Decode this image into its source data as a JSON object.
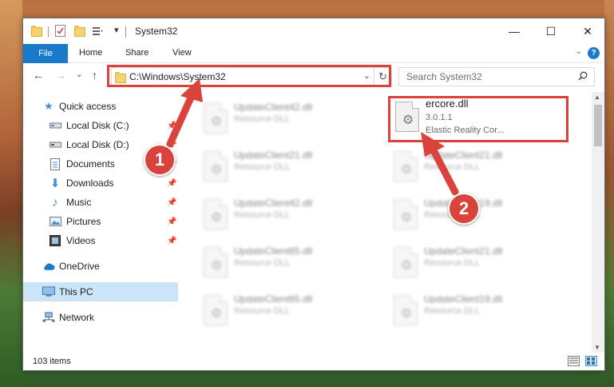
{
  "window": {
    "title": "System32",
    "controls": {
      "minimize": "—",
      "maximize": "☐",
      "close": "✕"
    }
  },
  "ribbon": {
    "file_tab": "File",
    "tabs": [
      "Home",
      "Share",
      "View"
    ],
    "help": "?"
  },
  "navigation": {
    "address": "C:\\Windows\\System32",
    "search_placeholder": "Search System32"
  },
  "sidebar": {
    "items": [
      {
        "label": "Quick access",
        "icon": "star-icon",
        "pinned": false,
        "selected": false
      },
      {
        "label": "Local Disk (C:)",
        "icon": "drive-icon",
        "pinned": true,
        "selected": false
      },
      {
        "label": "Local Disk (D:)",
        "icon": "drive-icon",
        "pinned": true,
        "selected": false
      },
      {
        "label": "Documents",
        "icon": "document-icon",
        "pinned": true,
        "selected": false
      },
      {
        "label": "Downloads",
        "icon": "download-icon",
        "pinned": true,
        "selected": false
      },
      {
        "label": "Music",
        "icon": "music-icon",
        "pinned": true,
        "selected": false
      },
      {
        "label": "Pictures",
        "icon": "pictures-icon",
        "pinned": true,
        "selected": false
      },
      {
        "label": "Videos",
        "icon": "videos-icon",
        "pinned": true,
        "selected": false
      },
      {
        "label": "OneDrive",
        "icon": "cloud-icon",
        "pinned": false,
        "selected": false
      },
      {
        "label": "This PC",
        "icon": "computer-icon",
        "pinned": false,
        "selected": true
      },
      {
        "label": "Network",
        "icon": "network-icon",
        "pinned": false,
        "selected": false
      }
    ]
  },
  "files": {
    "highlighted": {
      "name": "ercore.dll",
      "version": "3.0.1.1",
      "company": "Elastic Reality Cor..."
    },
    "left_column": [
      {
        "name": "UpdateClient42.dll",
        "type": "Resource DLL"
      },
      {
        "name": "UpdateClient21.dll",
        "type": "Resource DLL"
      },
      {
        "name": "UpdateClient42.dll",
        "type": "Resource DLL"
      },
      {
        "name": "UpdateClient65.dll",
        "type": "Resource DLL"
      },
      {
        "name": "UpdateClient65.dll",
        "type": "Resource DLL"
      }
    ],
    "right_column": [
      {
        "name": "UpdateClient21.dll",
        "type": "Resource DLL"
      },
      {
        "name": "UpdateClient19.dll",
        "type": "Resource DLL"
      },
      {
        "name": "UpdateClient21.dll",
        "type": "Resource DLL"
      },
      {
        "name": "UpdateClient19.dll",
        "type": "Resource DLL"
      }
    ]
  },
  "status": {
    "item_count": "103 items"
  },
  "annotations": {
    "step1": "1",
    "step2": "2",
    "color": "#d9433c"
  },
  "colors": {
    "file_tab": "#1979ca",
    "selection": "#cce4f7"
  }
}
